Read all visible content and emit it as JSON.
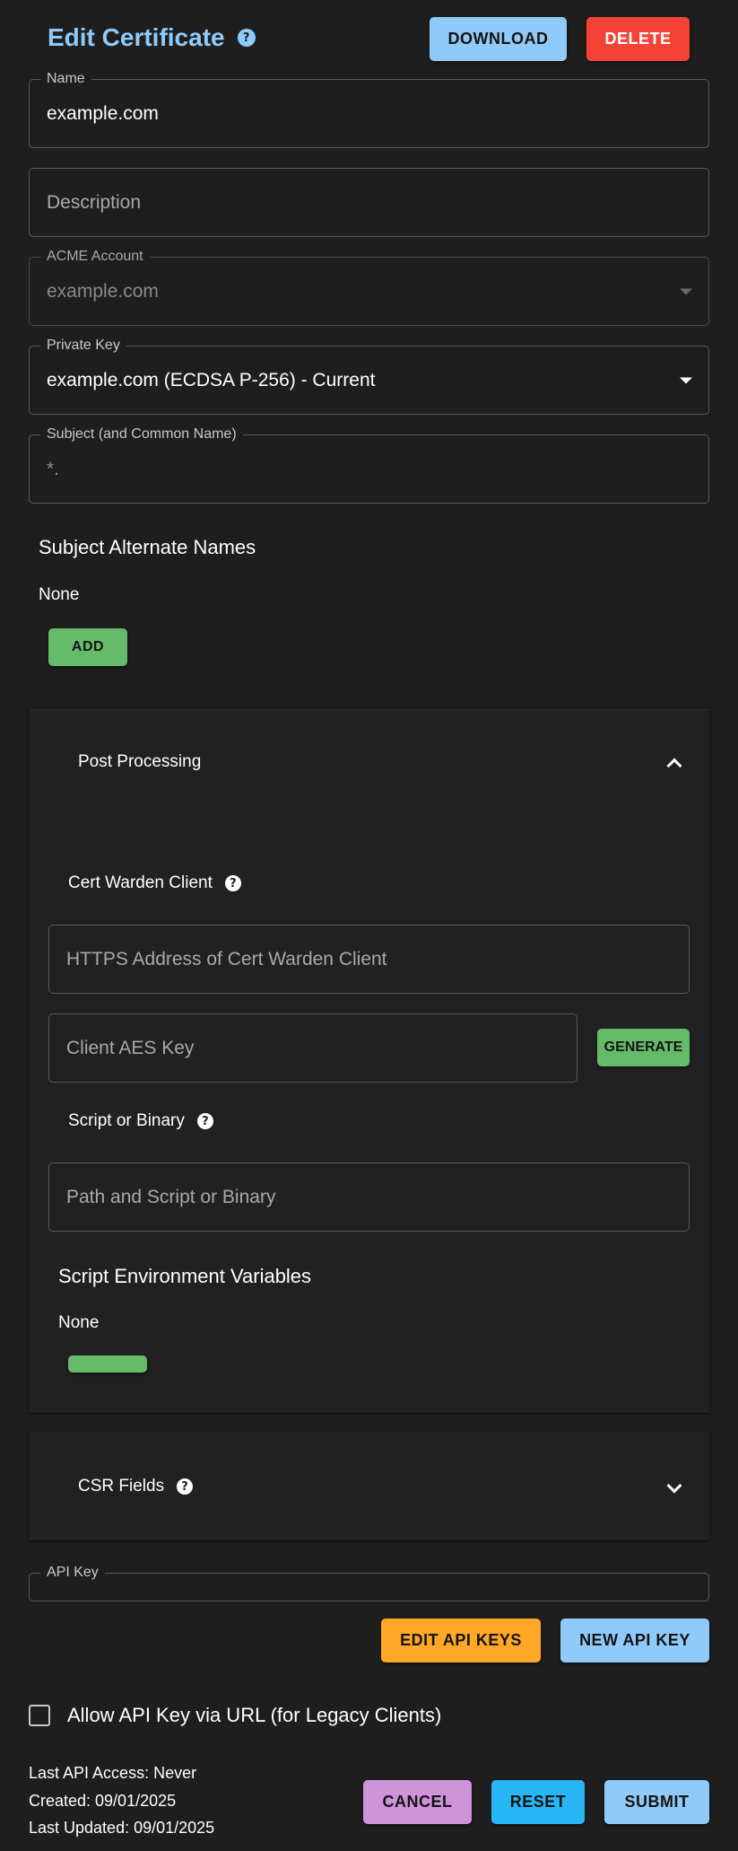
{
  "header": {
    "title": "Edit Certificate",
    "help_icon": "help-icon",
    "download_label": "DOWNLOAD",
    "delete_label": "DELETE"
  },
  "form": {
    "name": {
      "label": "Name",
      "value": "example.com"
    },
    "description": {
      "placeholder": "Description",
      "value": ""
    },
    "acme_account": {
      "label": "ACME Account",
      "value": "example.com"
    },
    "private_key": {
      "label": "Private Key",
      "value": "example.com (ECDSA P-256) - Current"
    },
    "subject": {
      "label": "Subject (and Common Name)",
      "value": "*."
    }
  },
  "san": {
    "heading": "Subject Alternate Names",
    "none_text": "None",
    "add_label": "ADD"
  },
  "post_processing": {
    "title": "Post Processing",
    "expanded": true,
    "client_heading": "Cert Warden Client",
    "client_address_placeholder": "HTTPS Address of Cert Warden Client",
    "client_aes_placeholder": "Client AES Key",
    "generate_label": "GENERATE",
    "script_heading": "Script or Binary",
    "script_placeholder": "Path and Script or Binary",
    "env_heading": "Script Environment Variables",
    "env_none_text": "None"
  },
  "csr_fields": {
    "title": "CSR Fields",
    "expanded": false
  },
  "api_key": {
    "label": "API Key",
    "value": "",
    "edit_label": "EDIT API KEYS",
    "new_label": "NEW API KEY",
    "legacy_checkbox_label": "Allow API Key via URL (for Legacy Clients)",
    "legacy_checked": false
  },
  "footer": {
    "last_access": "Last API Access: Never",
    "created": "Created: 09/01/2025",
    "updated": "Last Updated: 09/01/2025",
    "cancel_label": "CANCEL",
    "reset_label": "RESET",
    "submit_label": "SUBMIT"
  },
  "colors": {
    "background": "#1e1e1e",
    "title": "#90caf9",
    "primary": "#90caf9",
    "error": "#f44336",
    "success": "#66bb6a",
    "warning": "#ffa726",
    "secondary": "#ce93d8",
    "info": "#29b6f6"
  }
}
